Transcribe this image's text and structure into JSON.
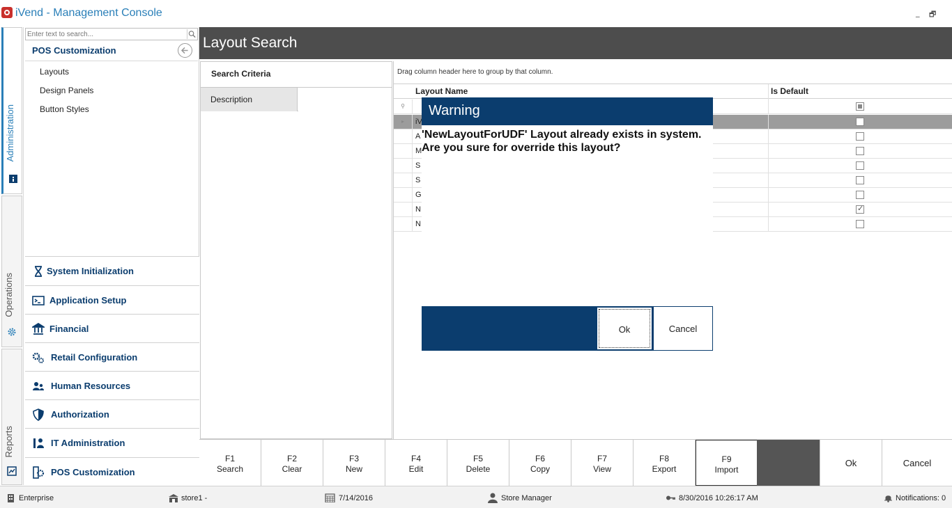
{
  "window": {
    "title": "iVend - Management Console",
    "min": "_",
    "restore": "🗗"
  },
  "vtabs": [
    {
      "label": "Administration",
      "active": true
    },
    {
      "label": "Operations",
      "active": false
    },
    {
      "label": "Reports",
      "active": false
    }
  ],
  "nav": {
    "search_placeholder": "Enter text to search...",
    "header": "POS Customization",
    "items": [
      "Layouts",
      "Design Panels",
      "Button Styles"
    ],
    "modules": [
      {
        "label": "System Initialization",
        "icon": "hourglass-icon"
      },
      {
        "label": "Application Setup",
        "icon": "terminal-icon"
      },
      {
        "label": "Financial",
        "icon": "bank-icon"
      },
      {
        "label": "Retail Configuration",
        "icon": "gears-icon"
      },
      {
        "label": "Human Resources",
        "icon": "people-icon"
      },
      {
        "label": "Authorization",
        "icon": "shield-icon"
      },
      {
        "label": "IT Administration",
        "icon": "it-admin-icon"
      },
      {
        "label": "POS Customization",
        "icon": "pos-gear-icon"
      }
    ]
  },
  "main": {
    "title": "Layout Search",
    "criteria": {
      "title": "Search Criteria",
      "description_label": "Description",
      "description_value": ""
    },
    "grid": {
      "group_hint": "Drag column header here to group by that column.",
      "columns": [
        "Layout Name",
        "Is Default"
      ],
      "rows": [
        {
          "name": "iV",
          "is_default": false,
          "selected": true
        },
        {
          "name": "A",
          "is_default": false
        },
        {
          "name": "M",
          "is_default": false
        },
        {
          "name": "S",
          "is_default": false
        },
        {
          "name": "S",
          "is_default": false
        },
        {
          "name": "G",
          "is_default": false
        },
        {
          "name": "N",
          "is_default": true
        },
        {
          "name": "N",
          "is_default": false
        }
      ]
    }
  },
  "dialog": {
    "title": "Warning",
    "message": "'NewLayoutForUDF' Layout already exists in system. Are you sure for override this layout?",
    "ok": "Ok",
    "cancel": "Cancel"
  },
  "fkeys": [
    {
      "key": "F1",
      "label": "Search"
    },
    {
      "key": "F2",
      "label": "Clear"
    },
    {
      "key": "F3",
      "label": "New"
    },
    {
      "key": "F4",
      "label": "Edit"
    },
    {
      "key": "F5",
      "label": "Delete"
    },
    {
      "key": "F6",
      "label": "Copy"
    },
    {
      "key": "F7",
      "label": "View"
    },
    {
      "key": "F8",
      "label": "Export"
    },
    {
      "key": "F9",
      "label": "Import"
    }
  ],
  "actions": {
    "ok": "Ok",
    "cancel": "Cancel"
  },
  "status": {
    "company": "Enterprise",
    "store": "store1 -",
    "date": "7/14/2016",
    "user": "Store Manager",
    "login": "8/30/2016 10:26:17 AM",
    "notifications": "Notifications: 0"
  },
  "colors": {
    "brand_navy": "#0b3d6e",
    "header_gray": "#4d4d4d",
    "accent_blue": "#2a7fb8"
  }
}
